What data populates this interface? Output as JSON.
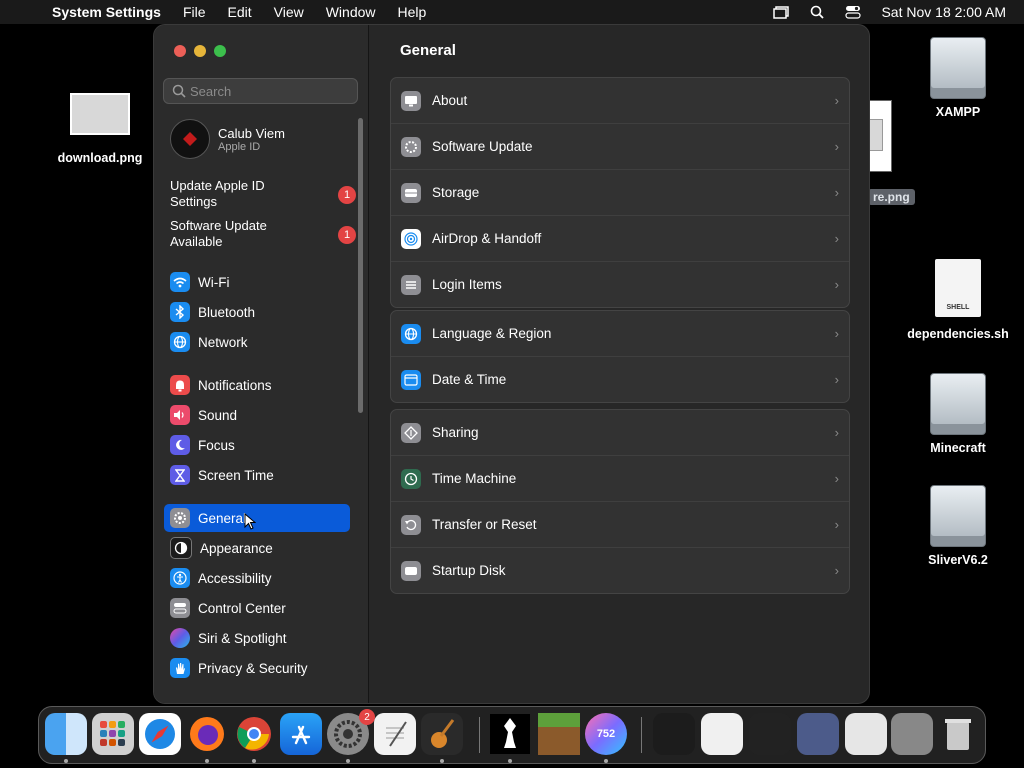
{
  "menubar": {
    "app_name": "System Settings",
    "menus": [
      "File",
      "Edit",
      "View",
      "Window",
      "Help"
    ],
    "clock": "Sat Nov 18  2:00 AM"
  },
  "desktop": {
    "download_label": "download.png",
    "partial_label": "re.png",
    "xampp_label": "XAMPP",
    "deps_label": "dependencies.sh",
    "deps_file_text": "SHELL",
    "minecraft_label": "Minecraft",
    "sliver_label": "SliverV6.2"
  },
  "sidebar": {
    "search_placeholder": "Search",
    "account_name": "Calub Viem",
    "account_sub": "Apple ID",
    "notice1": "Update Apple ID Settings",
    "notice1_badge": "1",
    "notice2": "Software Update Available",
    "notice2_badge": "1",
    "items": [
      {
        "label": "Wi-Fi",
        "color": "#1a8cf0"
      },
      {
        "label": "Bluetooth",
        "color": "#1a8cf0"
      },
      {
        "label": "Network",
        "color": "#1a8cf0"
      },
      {
        "label": "Notifications",
        "color": "#ec4b4b"
      },
      {
        "label": "Sound",
        "color": "#ec4b6b"
      },
      {
        "label": "Focus",
        "color": "#5e5ce6"
      },
      {
        "label": "Screen Time",
        "color": "#5e5ce6"
      },
      {
        "label": "General",
        "color": "#8e8e93"
      },
      {
        "label": "Appearance",
        "color": "#1c1c1c"
      },
      {
        "label": "Accessibility",
        "color": "#1a8cf0"
      },
      {
        "label": "Control Center",
        "color": "#8e8e93"
      },
      {
        "label": "Siri & Spotlight",
        "color": "#b53fd6"
      },
      {
        "label": "Privacy & Security",
        "color": "#1a8cf0"
      }
    ]
  },
  "content": {
    "title": "General",
    "group1": [
      "About",
      "Software Update",
      "Storage",
      "AirDrop & Handoff",
      "Login Items"
    ],
    "group2": [
      "Language & Region",
      "Date & Time"
    ],
    "group3": [
      "Sharing",
      "Time Machine",
      "Transfer or Reset",
      "Startup Disk"
    ]
  },
  "dock": {
    "settings_badge": "2",
    "chess_count": "752"
  }
}
